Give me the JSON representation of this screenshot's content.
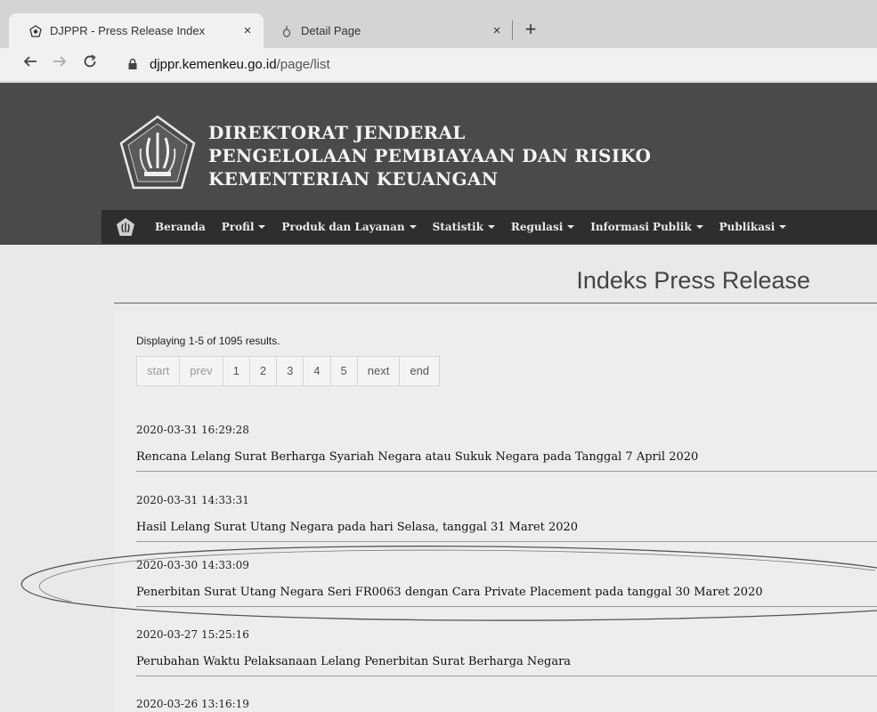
{
  "browser": {
    "tabs": [
      {
        "title": "DJPPR - Press Release Index",
        "active": true
      },
      {
        "title": "Detail Page",
        "active": false
      }
    ],
    "close_glyph": "×",
    "new_tab_glyph": "+",
    "url_domain": "djppr.kemenkeu.go.id",
    "url_path": "/page/list",
    "icons": [
      "back-arrow-icon",
      "forward-arrow-icon",
      "reload-icon",
      "lock-icon",
      "tab-close-icon",
      "new-tab-icon"
    ]
  },
  "header": {
    "org_line_1": "DIREKTORAT JENDERAL",
    "org_line_2": "PENGELOLAAN PEMBIAYAAN DAN RISIKO",
    "org_line_3": "KEMENTERIAN KEUANGAN"
  },
  "menu": {
    "items": [
      {
        "label": "Beranda",
        "dropdown": false
      },
      {
        "label": "Profil",
        "dropdown": true
      },
      {
        "label": "Produk dan Layanan",
        "dropdown": true
      },
      {
        "label": "Statistik",
        "dropdown": true
      },
      {
        "label": "Regulasi",
        "dropdown": true
      },
      {
        "label": "Informasi Publik",
        "dropdown": true
      },
      {
        "label": "Publikasi",
        "dropdown": true
      }
    ]
  },
  "page": {
    "title": "Indeks Press Release",
    "summary": "Displaying 1-5 of 1095 results.",
    "pager": [
      "start",
      "prev",
      "1",
      "2",
      "3",
      "4",
      "5",
      "next",
      "end"
    ]
  },
  "entries": [
    {
      "date": "2020-03-31 16:29:28",
      "title": "Rencana Lelang Surat Berharga Syariah Negara atau Sukuk Negara pada Tanggal 7 April 2020"
    },
    {
      "date": "2020-03-31 14:33:31",
      "title": "Hasil Lelang Surat Utang Negara pada hari Selasa, tanggal 31 Maret 2020"
    },
    {
      "date": "2020-03-30 14:33:09",
      "title": "Penerbitan Surat Utang Negara Seri FR0063 dengan Cara Private Placement pada tanggal 30 Maret 2020"
    },
    {
      "date": "2020-03-27 15:25:16",
      "title": "Perubahan Waktu Pelaksanaan Lelang Penerbitan Surat Berharga Negara"
    },
    {
      "date": "2020-03-26 13:16:19",
      "title": ""
    }
  ],
  "colors": {
    "header_bg": "#4a4a4a",
    "menu_bg": "#2e2e2e",
    "page_bg": "#ededed"
  }
}
